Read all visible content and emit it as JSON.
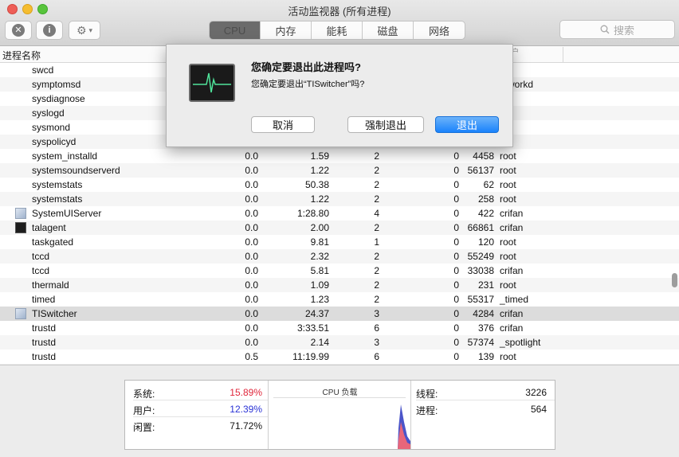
{
  "window": {
    "title": "活动监视器 (所有进程)"
  },
  "toolbar": {
    "tabs": [
      {
        "label": "CPU",
        "active": true
      },
      {
        "label": "内存",
        "active": false
      },
      {
        "label": "能耗",
        "active": false
      },
      {
        "label": "磁盘",
        "active": false
      },
      {
        "label": "网络",
        "active": false
      }
    ],
    "search_placeholder": "搜索",
    "icons": {
      "stop": "close-icon",
      "info": "info-icon",
      "action": "gear-icon"
    }
  },
  "table": {
    "header_name": "进程名称",
    "header_partial_right": "户",
    "rows": [
      {
        "name": "swcd",
        "cpu": "",
        "time": "",
        "threads": "",
        "ports": "",
        "pid": "",
        "user": "an",
        "icon": ""
      },
      {
        "name": "symptomsd",
        "cpu": "",
        "time": "",
        "threads": "",
        "ports": "",
        "pid": "",
        "user": "etworkd",
        "icon": ""
      },
      {
        "name": "sysdiagnose",
        "cpu": "",
        "time": "",
        "threads": "",
        "ports": "",
        "pid": "",
        "user": "ot",
        "icon": ""
      },
      {
        "name": "syslogd",
        "cpu": "",
        "time": "",
        "threads": "",
        "ports": "",
        "pid": "",
        "user": "t",
        "icon": ""
      },
      {
        "name": "sysmond",
        "cpu": "",
        "time": "",
        "threads": "",
        "ports": "",
        "pid": "",
        "user": "t",
        "icon": ""
      },
      {
        "name": "syspolicyd",
        "cpu": "",
        "time": "",
        "threads": "",
        "ports": "",
        "pid": "",
        "user": "t",
        "icon": ""
      },
      {
        "name": "system_installd",
        "cpu": "0.0",
        "time": "1.59",
        "threads": "2",
        "ports": "0",
        "pid": "4458",
        "user": "root",
        "icon": ""
      },
      {
        "name": "systemsoundserverd",
        "cpu": "0.0",
        "time": "1.22",
        "threads": "2",
        "ports": "0",
        "pid": "56137",
        "user": "root",
        "icon": ""
      },
      {
        "name": "systemstats",
        "cpu": "0.0",
        "time": "50.38",
        "threads": "2",
        "ports": "0",
        "pid": "62",
        "user": "root",
        "icon": ""
      },
      {
        "name": "systemstats",
        "cpu": "0.0",
        "time": "1.22",
        "threads": "2",
        "ports": "0",
        "pid": "258",
        "user": "root",
        "icon": ""
      },
      {
        "name": "SystemUIServer",
        "cpu": "0.0",
        "time": "1:28.80",
        "threads": "4",
        "ports": "0",
        "pid": "422",
        "user": "crifan",
        "icon": "app"
      },
      {
        "name": "talagent",
        "cpu": "0.0",
        "time": "2.00",
        "threads": "2",
        "ports": "0",
        "pid": "66861",
        "user": "crifan",
        "icon": "term"
      },
      {
        "name": "taskgated",
        "cpu": "0.0",
        "time": "9.81",
        "threads": "1",
        "ports": "0",
        "pid": "120",
        "user": "root",
        "icon": ""
      },
      {
        "name": "tccd",
        "cpu": "0.0",
        "time": "2.32",
        "threads": "2",
        "ports": "0",
        "pid": "55249",
        "user": "root",
        "icon": ""
      },
      {
        "name": "tccd",
        "cpu": "0.0",
        "time": "5.81",
        "threads": "2",
        "ports": "0",
        "pid": "33038",
        "user": "crifan",
        "icon": ""
      },
      {
        "name": "thermald",
        "cpu": "0.0",
        "time": "1.09",
        "threads": "2",
        "ports": "0",
        "pid": "231",
        "user": "root",
        "icon": ""
      },
      {
        "name": "timed",
        "cpu": "0.0",
        "time": "1.23",
        "threads": "2",
        "ports": "0",
        "pid": "55317",
        "user": "_timed",
        "icon": ""
      },
      {
        "name": "TISwitcher",
        "cpu": "0.0",
        "time": "24.37",
        "threads": "3",
        "ports": "0",
        "pid": "4284",
        "user": "crifan",
        "icon": "app",
        "selected": true
      },
      {
        "name": "trustd",
        "cpu": "0.0",
        "time": "3:33.51",
        "threads": "6",
        "ports": "0",
        "pid": "376",
        "user": "crifan",
        "icon": ""
      },
      {
        "name": "trustd",
        "cpu": "0.0",
        "time": "2.14",
        "threads": "3",
        "ports": "0",
        "pid": "57374",
        "user": "_spotlight",
        "icon": ""
      },
      {
        "name": "trustd",
        "cpu": "0.5",
        "time": "11:19.99",
        "threads": "6",
        "ports": "0",
        "pid": "139",
        "user": "root",
        "icon": ""
      }
    ]
  },
  "stats": {
    "system_label": "系统:",
    "system_value": "15.89%",
    "user_label": "用户:",
    "user_value": "12.39%",
    "idle_label": "闲置:",
    "idle_value": "71.72%",
    "cpu_load_title": "CPU 负载",
    "threads_label": "线程:",
    "threads_value": "3226",
    "processes_label": "进程:",
    "processes_value": "564",
    "colors": {
      "system": "#e0263b",
      "user": "#2a33d6"
    }
  },
  "dialog": {
    "title": "您确定要退出此进程吗?",
    "message": "您确定要退出“TISwitcher”吗?",
    "cancel_label": "取消",
    "force_quit_label": "强制退出",
    "quit_label": "退出"
  }
}
